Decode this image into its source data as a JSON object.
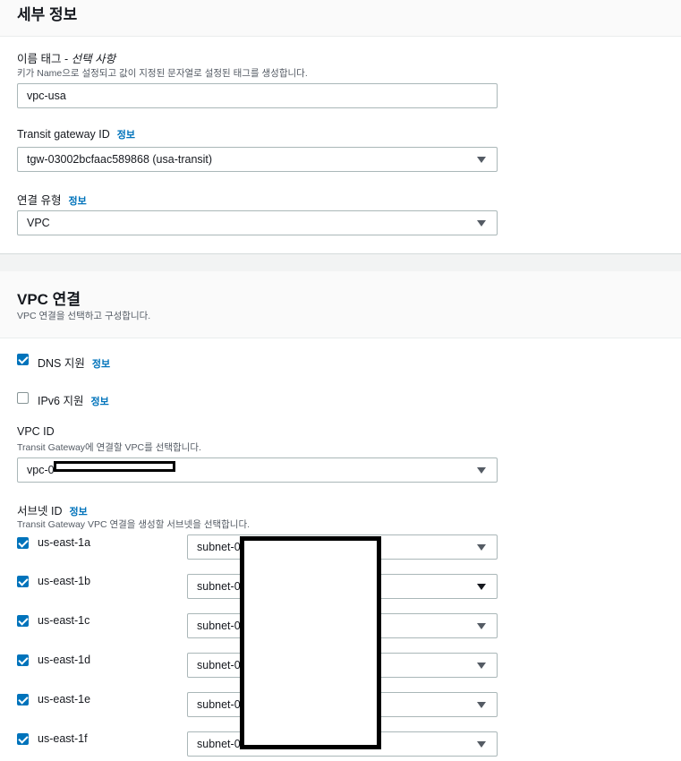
{
  "details": {
    "title": "세부 정보",
    "name_tag_label": "이름 태그 - ",
    "name_tag_optional": "선택 사항",
    "name_tag_desc": "키가 Name으로 설정되고 값이 지정된 문자열로 설정된 태그를 생성합니다.",
    "name_tag_value": "vpc-usa",
    "tgw_label": "Transit gateway ID",
    "tgw_value": "tgw-03002bcfaac589868 (usa-transit)",
    "attach_type_label": "연결 유형",
    "attach_type_value": "VPC"
  },
  "info_link": "정보",
  "vpc_attachment": {
    "title": "VPC 연결",
    "desc": "VPC 연결을 선택하고 구성합니다.",
    "dns_label": "DNS 지원",
    "dns_checked": true,
    "ipv6_label": "IPv6 지원",
    "ipv6_checked": false,
    "vpc_id_label": "VPC ID",
    "vpc_id_desc": "Transit Gateway에 연결할 VPC를 선택합니다.",
    "vpc_id_value": "vpc-0",
    "subnet_label": "서브넷 ID",
    "subnet_desc": "Transit Gateway VPC 연결을 생성할 서브넷을 선택합니다.",
    "subnets": [
      {
        "az": "us-east-1a",
        "value": "subnet-0",
        "checked": true
      },
      {
        "az": "us-east-1b",
        "value": "subnet-0",
        "checked": true
      },
      {
        "az": "us-east-1c",
        "value": "subnet-0",
        "checked": true
      },
      {
        "az": "us-east-1d",
        "value": "subnet-0",
        "checked": true
      },
      {
        "az": "us-east-1e",
        "value": "subnet-0",
        "checked": true
      },
      {
        "az": "us-east-1f",
        "value": "subnet-0",
        "checked": true
      }
    ]
  },
  "colors": {
    "accent": "#0073bb",
    "header_bg": "#fafafa",
    "border": "#aab7b8"
  }
}
